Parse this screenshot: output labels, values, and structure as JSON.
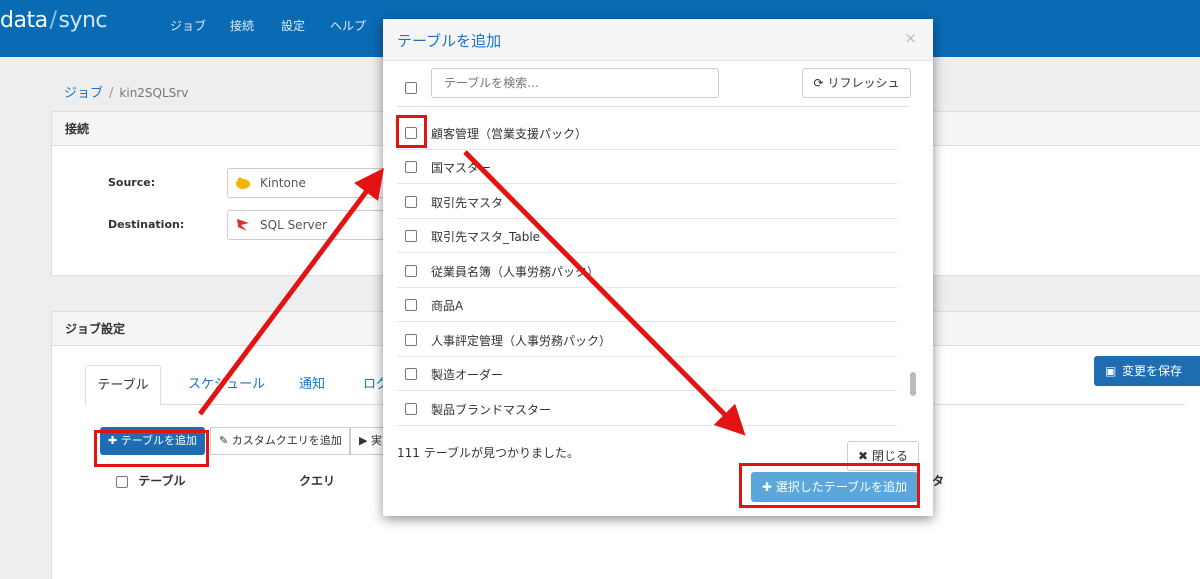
{
  "app": {
    "logo_data": "data",
    "logo_sep": "/",
    "logo_sync": "sync",
    "nav": [
      "ジョブ",
      "接続",
      "設定",
      "ヘルプ"
    ]
  },
  "breadcrumb": {
    "root": "ジョブ",
    "current": "kin2SQLSrv"
  },
  "connection_panel": {
    "title": "接続",
    "source_label": "Source:",
    "source_value": "Kintone",
    "destination_label": "Destination:",
    "destination_value": "SQL Server"
  },
  "job_panel": {
    "title": "ジョブ設定",
    "tabs": [
      "テーブル",
      "スケジュール",
      "通知",
      "ログ"
    ],
    "save_button": "変更を保存",
    "add_table_button": "テーブルを追加",
    "custom_query_button": "カスタムクエリを追加",
    "exec_button": "実",
    "columns": [
      "テーブル",
      "クエリ",
      "タ"
    ]
  },
  "modal": {
    "title": "テーブルを追加",
    "close_glyph": "×",
    "search_placeholder": "テーブルを検索...",
    "refresh_button": "リフレッシュ",
    "items": [
      "顧客管理（営業支援パック）",
      "国マスター",
      "取引先マスタ",
      "取引先マスタ_Table",
      "従業員名簿（人事労務パック）",
      "商品A",
      "人事評定管理（人事労務パック）",
      "製造オーダー",
      "製品ブランドマスター"
    ],
    "count_text": "111 テーブルが見つかりました。",
    "close_button": "閉じる",
    "add_selected_button": "選択したテーブルを追加"
  },
  "colors": {
    "nav_bg": "#0a6bb5",
    "primary": "#1e6db3",
    "link": "#1a73c7",
    "highlight": "#e31313",
    "add_selected": "#5ba7dc"
  }
}
